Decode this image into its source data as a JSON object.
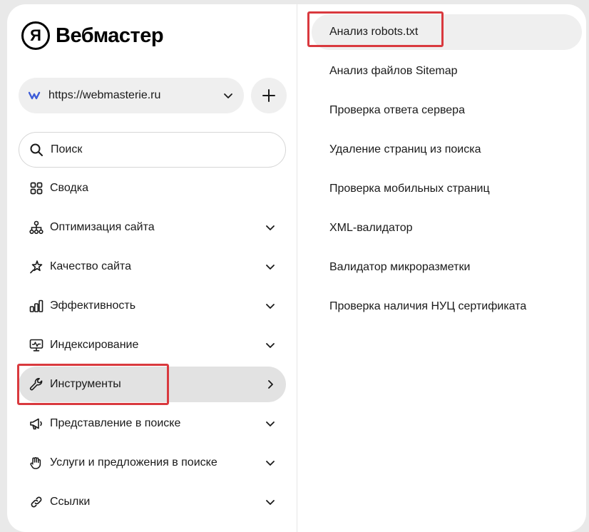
{
  "brand": {
    "logo_letter": "Я",
    "name": "Вебмастер"
  },
  "site_selector": {
    "url": "https://webmasterie.ru",
    "favicon": "w-logo-icon",
    "accent_color": "#3d5cd8"
  },
  "search": {
    "placeholder": "Поиск"
  },
  "nav": {
    "items": [
      {
        "label": "Сводка",
        "icon": "grid-icon",
        "chevron": "none"
      },
      {
        "label": "Оптимизация сайта",
        "icon": "sitemap-icon",
        "chevron": "down"
      },
      {
        "label": "Качество сайта",
        "icon": "sparkle-icon",
        "chevron": "down"
      },
      {
        "label": "Эффективность",
        "icon": "bar-chart-icon",
        "chevron": "down"
      },
      {
        "label": "Индексирование",
        "icon": "monitor-icon",
        "chevron": "down"
      },
      {
        "label": "Инструменты",
        "icon": "wrench-icon",
        "chevron": "right",
        "active": true
      },
      {
        "label": "Представление в поиске",
        "icon": "megaphone-icon",
        "chevron": "down"
      },
      {
        "label": "Услуги и предложения в поиске",
        "icon": "hand-icon",
        "chevron": "down"
      },
      {
        "label": "Ссылки",
        "icon": "link-icon",
        "chevron": "down"
      }
    ]
  },
  "tools_submenu": {
    "items": [
      {
        "label": "Анализ robots.txt",
        "active": true
      },
      {
        "label": "Анализ файлов Sitemap"
      },
      {
        "label": "Проверка ответа сервера"
      },
      {
        "label": "Удаление страниц из поиска"
      },
      {
        "label": "Проверка мобильных страниц"
      },
      {
        "label": "XML-валидатор"
      },
      {
        "label": "Валидатор микроразметки"
      },
      {
        "label": "Проверка наличия НУЦ сертификата"
      }
    ]
  },
  "colors": {
    "highlight": "#d9393e",
    "active_bg": "#e2e2e2",
    "page_bg": "#e9e9e9"
  }
}
